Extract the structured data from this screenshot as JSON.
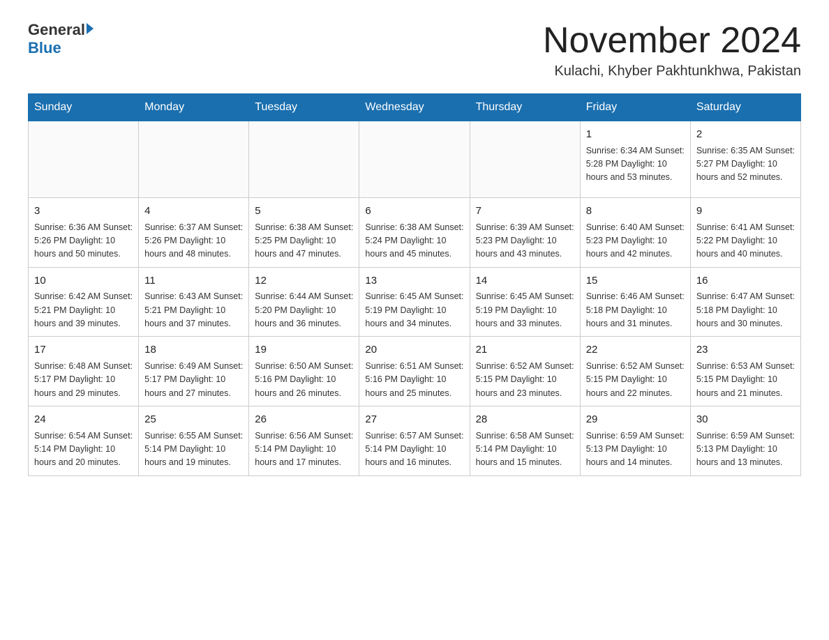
{
  "header": {
    "logo_general": "General",
    "logo_blue": "Blue",
    "month_title": "November 2024",
    "location": "Kulachi, Khyber Pakhtunkhwa, Pakistan"
  },
  "weekdays": [
    "Sunday",
    "Monday",
    "Tuesday",
    "Wednesday",
    "Thursday",
    "Friday",
    "Saturday"
  ],
  "weeks": [
    [
      {
        "day": "",
        "info": ""
      },
      {
        "day": "",
        "info": ""
      },
      {
        "day": "",
        "info": ""
      },
      {
        "day": "",
        "info": ""
      },
      {
        "day": "",
        "info": ""
      },
      {
        "day": "1",
        "info": "Sunrise: 6:34 AM\nSunset: 5:28 PM\nDaylight: 10 hours and 53 minutes."
      },
      {
        "day": "2",
        "info": "Sunrise: 6:35 AM\nSunset: 5:27 PM\nDaylight: 10 hours and 52 minutes."
      }
    ],
    [
      {
        "day": "3",
        "info": "Sunrise: 6:36 AM\nSunset: 5:26 PM\nDaylight: 10 hours and 50 minutes."
      },
      {
        "day": "4",
        "info": "Sunrise: 6:37 AM\nSunset: 5:26 PM\nDaylight: 10 hours and 48 minutes."
      },
      {
        "day": "5",
        "info": "Sunrise: 6:38 AM\nSunset: 5:25 PM\nDaylight: 10 hours and 47 minutes."
      },
      {
        "day": "6",
        "info": "Sunrise: 6:38 AM\nSunset: 5:24 PM\nDaylight: 10 hours and 45 minutes."
      },
      {
        "day": "7",
        "info": "Sunrise: 6:39 AM\nSunset: 5:23 PM\nDaylight: 10 hours and 43 minutes."
      },
      {
        "day": "8",
        "info": "Sunrise: 6:40 AM\nSunset: 5:23 PM\nDaylight: 10 hours and 42 minutes."
      },
      {
        "day": "9",
        "info": "Sunrise: 6:41 AM\nSunset: 5:22 PM\nDaylight: 10 hours and 40 minutes."
      }
    ],
    [
      {
        "day": "10",
        "info": "Sunrise: 6:42 AM\nSunset: 5:21 PM\nDaylight: 10 hours and 39 minutes."
      },
      {
        "day": "11",
        "info": "Sunrise: 6:43 AM\nSunset: 5:21 PM\nDaylight: 10 hours and 37 minutes."
      },
      {
        "day": "12",
        "info": "Sunrise: 6:44 AM\nSunset: 5:20 PM\nDaylight: 10 hours and 36 minutes."
      },
      {
        "day": "13",
        "info": "Sunrise: 6:45 AM\nSunset: 5:19 PM\nDaylight: 10 hours and 34 minutes."
      },
      {
        "day": "14",
        "info": "Sunrise: 6:45 AM\nSunset: 5:19 PM\nDaylight: 10 hours and 33 minutes."
      },
      {
        "day": "15",
        "info": "Sunrise: 6:46 AM\nSunset: 5:18 PM\nDaylight: 10 hours and 31 minutes."
      },
      {
        "day": "16",
        "info": "Sunrise: 6:47 AM\nSunset: 5:18 PM\nDaylight: 10 hours and 30 minutes."
      }
    ],
    [
      {
        "day": "17",
        "info": "Sunrise: 6:48 AM\nSunset: 5:17 PM\nDaylight: 10 hours and 29 minutes."
      },
      {
        "day": "18",
        "info": "Sunrise: 6:49 AM\nSunset: 5:17 PM\nDaylight: 10 hours and 27 minutes."
      },
      {
        "day": "19",
        "info": "Sunrise: 6:50 AM\nSunset: 5:16 PM\nDaylight: 10 hours and 26 minutes."
      },
      {
        "day": "20",
        "info": "Sunrise: 6:51 AM\nSunset: 5:16 PM\nDaylight: 10 hours and 25 minutes."
      },
      {
        "day": "21",
        "info": "Sunrise: 6:52 AM\nSunset: 5:15 PM\nDaylight: 10 hours and 23 minutes."
      },
      {
        "day": "22",
        "info": "Sunrise: 6:52 AM\nSunset: 5:15 PM\nDaylight: 10 hours and 22 minutes."
      },
      {
        "day": "23",
        "info": "Sunrise: 6:53 AM\nSunset: 5:15 PM\nDaylight: 10 hours and 21 minutes."
      }
    ],
    [
      {
        "day": "24",
        "info": "Sunrise: 6:54 AM\nSunset: 5:14 PM\nDaylight: 10 hours and 20 minutes."
      },
      {
        "day": "25",
        "info": "Sunrise: 6:55 AM\nSunset: 5:14 PM\nDaylight: 10 hours and 19 minutes."
      },
      {
        "day": "26",
        "info": "Sunrise: 6:56 AM\nSunset: 5:14 PM\nDaylight: 10 hours and 17 minutes."
      },
      {
        "day": "27",
        "info": "Sunrise: 6:57 AM\nSunset: 5:14 PM\nDaylight: 10 hours and 16 minutes."
      },
      {
        "day": "28",
        "info": "Sunrise: 6:58 AM\nSunset: 5:14 PM\nDaylight: 10 hours and 15 minutes."
      },
      {
        "day": "29",
        "info": "Sunrise: 6:59 AM\nSunset: 5:13 PM\nDaylight: 10 hours and 14 minutes."
      },
      {
        "day": "30",
        "info": "Sunrise: 6:59 AM\nSunset: 5:13 PM\nDaylight: 10 hours and 13 minutes."
      }
    ]
  ]
}
